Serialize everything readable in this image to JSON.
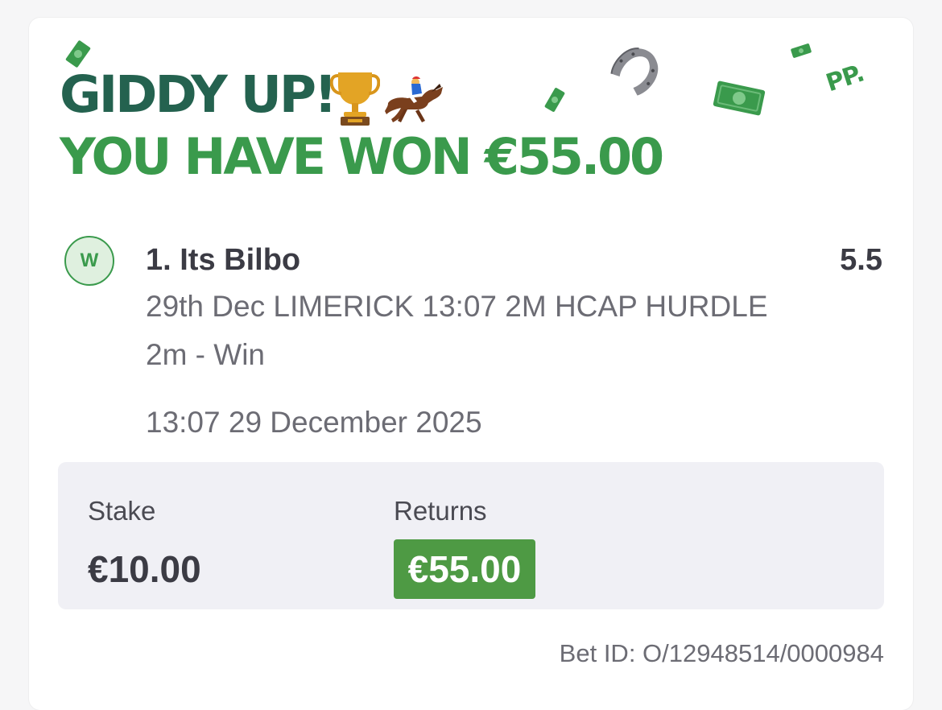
{
  "banner": {
    "headline_1": "GIDDY UP!",
    "headline_2": "YOU HAVE WON €55.00",
    "brand_mark": "PP.",
    "trophy_icon": "trophy-icon",
    "horse_icon": "horse-racing-icon",
    "horseshoe_icon": "horseshoe-icon",
    "money_icon": "banknote-icon"
  },
  "selection": {
    "badge": "W",
    "name": "1. Its Bilbo",
    "odds": "5.5",
    "event_line_1": "29th Dec LIMERICK 13:07 2M HCAP HURDLE",
    "event_line_2": "2m - Win",
    "event_datetime": "13:07 29 December 2025"
  },
  "totals": {
    "stake_label": "Stake",
    "stake_value": "€10.00",
    "returns_label": "Returns",
    "returns_value": "€55.00"
  },
  "footer": {
    "bet_id": "Bet ID: O/12948514/0000984"
  },
  "colors": {
    "headline_dark_green": "#24624f",
    "headline_green": "#3a9a4c",
    "returns_badge": "#4e9a44",
    "panel_bg": "#f0f0f5"
  }
}
